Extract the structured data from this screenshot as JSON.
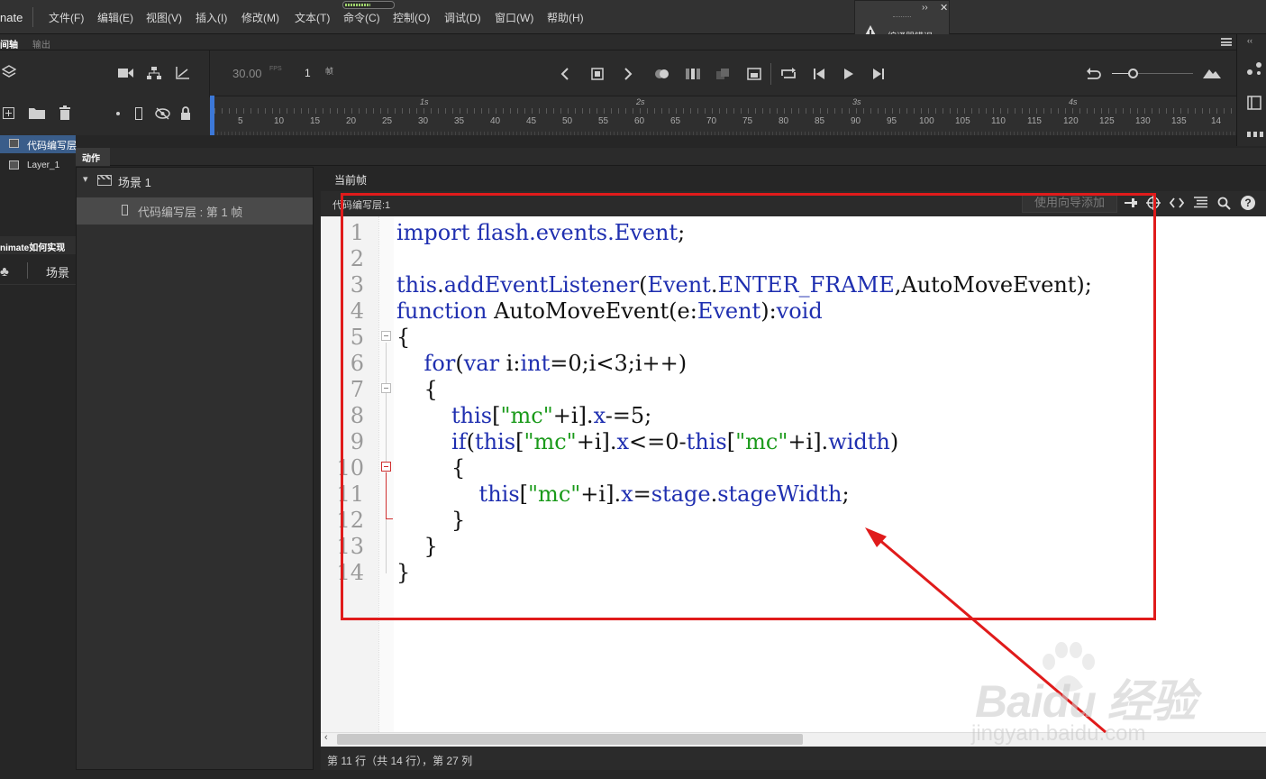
{
  "app": {
    "name": "nate"
  },
  "menu": [
    "文件(F)",
    "编辑(E)",
    "视图(V)",
    "插入(I)",
    "修改(M)",
    "文本(T)",
    "命令(C)",
    "控制(O)",
    "调试(D)",
    "窗口(W)",
    "帮助(H)"
  ],
  "compile_errors": {
    "label": "编译器错误",
    "collapse": "››",
    "close": "✕"
  },
  "timeline": {
    "tabs": {
      "timeline": "间轴",
      "output": "输出"
    },
    "fps": "30.00",
    "fps_unit": "FPS",
    "current_frame": "1",
    "frame_unit": "帧",
    "seconds": [
      "1s",
      "2s",
      "3s",
      "4s"
    ],
    "frame_numbers": [
      "5",
      "10",
      "15",
      "20",
      "25",
      "30",
      "35",
      "40",
      "45",
      "50",
      "55",
      "60",
      "65",
      "70",
      "75",
      "80",
      "85",
      "90",
      "95",
      "100",
      "105",
      "110",
      "115",
      "120",
      "125",
      "130",
      "135",
      "14"
    ]
  },
  "layers": [
    {
      "name": "代码编写层",
      "selected": true
    },
    {
      "name": "Layer_1",
      "selected": false
    }
  ],
  "library_panel": {
    "title": "nimate如何实现",
    "scene_label": "场景"
  },
  "actions": {
    "tab_label": "动作",
    "nav": {
      "scene": "场景 1",
      "frame_entry": "代码编写层 : 第 1 帧"
    },
    "current_frame_label": "当前帧",
    "script_path": "代码编写层:1",
    "wizard_button": "使用向导添加"
  },
  "code": {
    "line_numbers": [
      "1",
      "2",
      "3",
      "4",
      "5",
      "6",
      "7",
      "8",
      "9",
      "10",
      "11",
      "12",
      "13",
      "14"
    ]
  },
  "status": {
    "text": "第 11 行（共 14 行），第 27 列"
  },
  "watermark": {
    "brand": "Baidu 经验",
    "url": "jingyan.baidu.com"
  },
  "colors": {
    "annotation": "#e01b1b",
    "keyword": "#1f2fb0",
    "string": "#1a9a1a",
    "selection": "#3a5d8a"
  }
}
